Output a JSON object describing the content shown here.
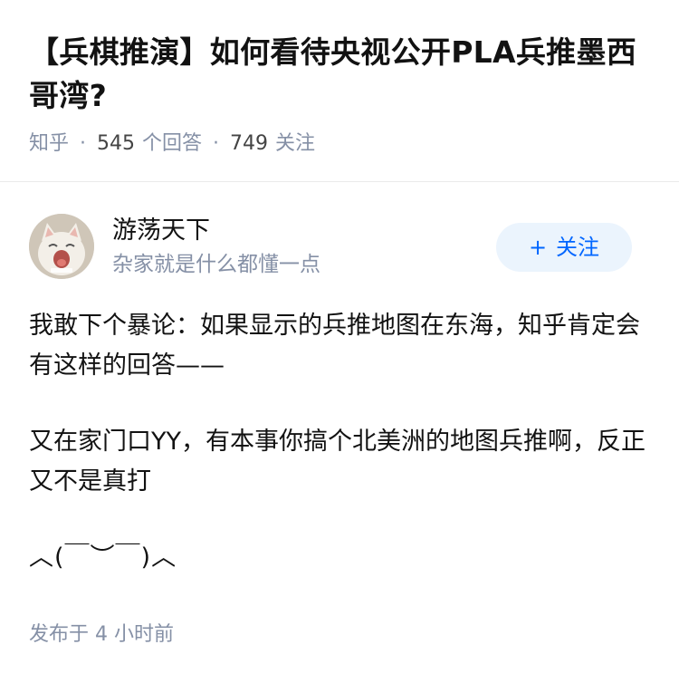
{
  "question": {
    "title": "【兵棋推演】如何看待央视公开PLA兵推墨西哥湾?",
    "source": "知乎",
    "answer_count": "545",
    "answer_label": "个回答",
    "follower_count": "749",
    "follower_label": "关注"
  },
  "author": {
    "name": "游荡天下",
    "bio": "杂家就是什么都懂一点",
    "follow_label": "关注",
    "follow_icon": "plus-icon"
  },
  "answer": {
    "paragraphs": [
      "我敢下个暴论：如果显示的兵推地图在东海，知乎肯定会有这样的回答——",
      "又在家门口YY，有本事你搞个北美洲的地图兵推啊，反正又不是真打",
      "︿(￣︶￣)︿"
    ],
    "publish_time": "发布于 4 小时前"
  },
  "colors": {
    "meta": "#8590a6",
    "accent": "#0066ff",
    "follow_bg": "#ebf4fd"
  }
}
